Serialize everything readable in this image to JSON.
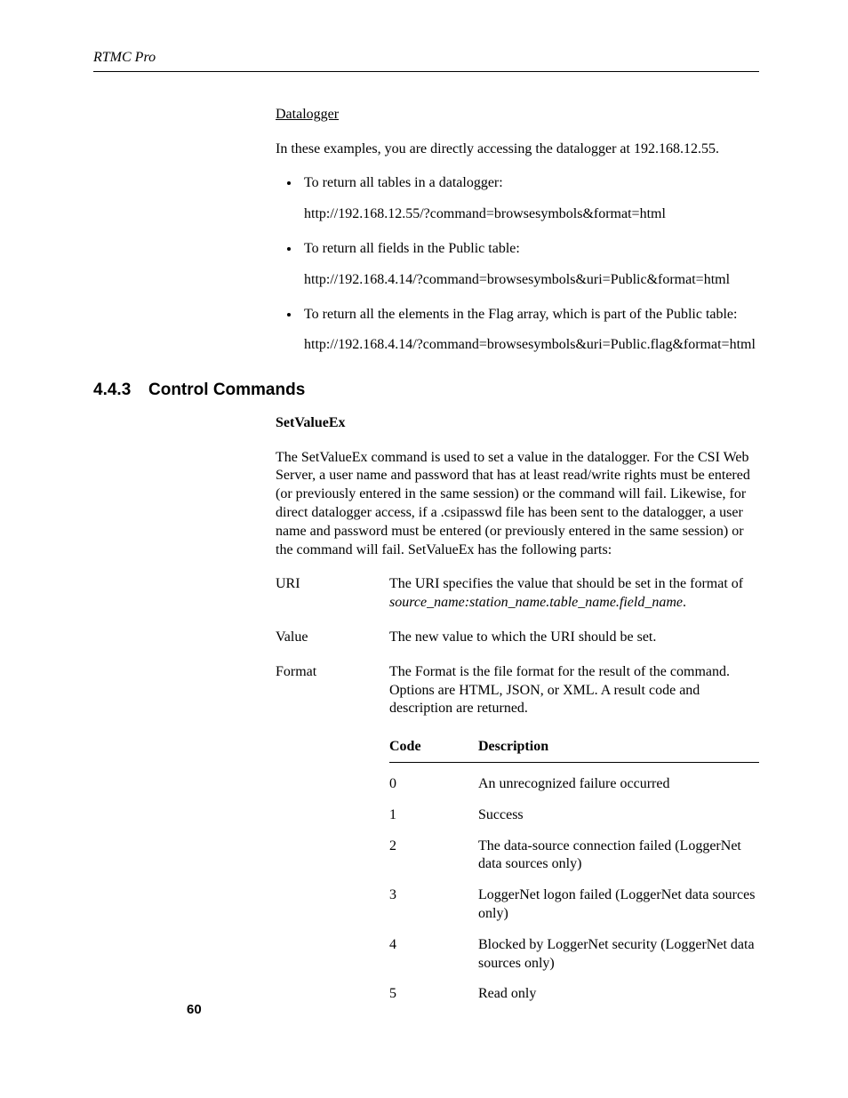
{
  "header": {
    "title": "RTMC Pro"
  },
  "datalogger": {
    "heading": "Datalogger",
    "intro": "In these examples, you are directly accessing the datalogger at 192.168.12.55.",
    "bullets": [
      {
        "text": "To return all tables in a datalogger:",
        "url": "http://192.168.12.55/?command=browsesymbols&format=html"
      },
      {
        "text": "To return all fields in the Public table:",
        "url": "http://192.168.4.14/?command=browsesymbols&uri=Public&format=html"
      },
      {
        "text": "To return all the elements in the Flag array, which is part of the Public table:",
        "url": "http://192.168.4.14/?command=browsesymbols&uri=Public.flag&format=html"
      }
    ]
  },
  "section": {
    "number": "4.4.3",
    "title": "Control Commands",
    "command_name": "SetValueEx",
    "description": "The SetValueEx command is used to set a value in the datalogger. For the CSI Web Server, a user name and password that has at least read/write rights must be entered (or previously entered in the same session) or the command will fail. Likewise, for direct datalogger access, if a .csipasswd file has been sent to the datalogger, a user name and password must be entered (or previously entered in the same session) or the command will fail. SetValueEx has the following parts:",
    "parts": [
      {
        "term": "URI",
        "desc_pre": "The URI specifies the value that should be set in the format of ",
        "desc_italic": "source_name:station_name.table_name.field_name",
        "desc_post": "."
      },
      {
        "term": "Value",
        "desc_pre": "The new value to which the URI should be set.",
        "desc_italic": "",
        "desc_post": ""
      },
      {
        "term": "Format",
        "desc_pre": "The Format is the file format for the result of the command. Options are HTML, JSON, or XML. A result code and description are returned.",
        "desc_italic": "",
        "desc_post": ""
      }
    ],
    "table": {
      "headers": {
        "code": "Code",
        "desc": "Description"
      },
      "rows": [
        {
          "code": "0",
          "desc": "An unrecognized failure occurred"
        },
        {
          "code": "1",
          "desc": "Success"
        },
        {
          "code": "2",
          "desc": "The data-source connection failed (LoggerNet data sources only)"
        },
        {
          "code": "3",
          "desc": "LoggerNet logon failed (LoggerNet data sources only)"
        },
        {
          "code": "4",
          "desc": "Blocked by LoggerNet security (LoggerNet data sources only)"
        },
        {
          "code": "5",
          "desc": "Read only"
        }
      ]
    }
  },
  "page_number": "60"
}
